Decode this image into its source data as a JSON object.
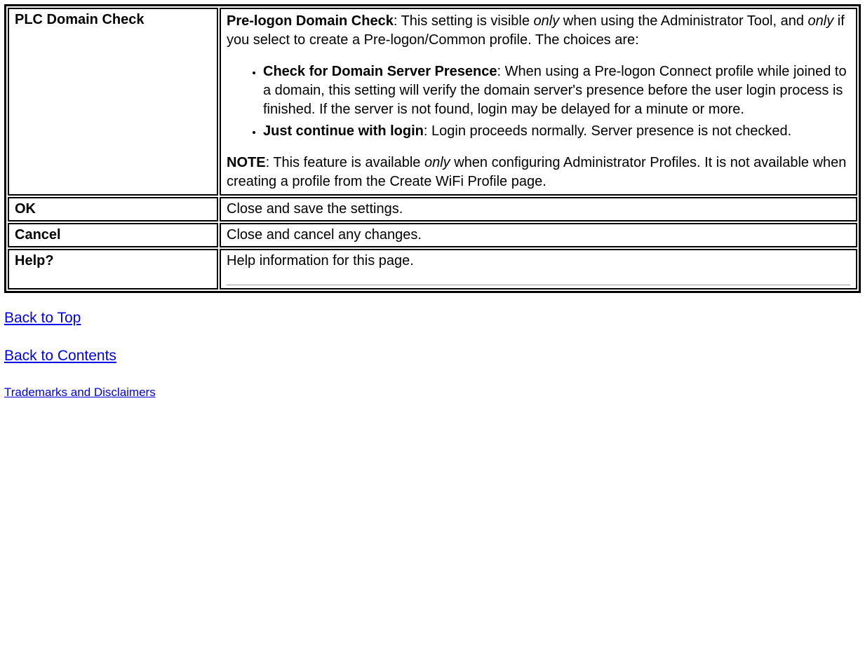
{
  "rows": {
    "plc": {
      "label": "PLC Domain Check",
      "intro_strong": "Pre-logon Domain Check",
      "intro_rest_1": ": This setting is visible ",
      "intro_only": "only",
      "intro_rest_2": " when using the Administrator Tool, and ",
      "intro_rest_3": " if you select to create a Pre-logon/Common profile. The choices are:",
      "item1_strong": "Check for Domain Server Presence",
      "item1_rest": ": When using a Pre-logon Connect profile while joined to a domain, this setting will verify the domain server's presence before the user login process is finished. If the server is not found, login may be delayed for a minute or more.",
      "item2_strong": "Just continue with login",
      "item2_rest": ": Login proceeds normally. Server presence is not checked.",
      "note_strong": "NOTE",
      "note_rest_1": ": This feature is available ",
      "note_rest_2": " when configuring Administrator Profiles. It is not available when creating a profile from the Create WiFi Profile page."
    },
    "ok": {
      "label": "OK",
      "desc": "Close and save the settings."
    },
    "cancel": {
      "label": "Cancel",
      "desc": "Close and cancel any changes."
    },
    "help": {
      "label": "Help?",
      "desc": "Help information for this page."
    }
  },
  "links": {
    "back_top": "Back to Top",
    "back_contents": "Back to Contents",
    "trademarks": "Trademarks and Disclaimers"
  }
}
